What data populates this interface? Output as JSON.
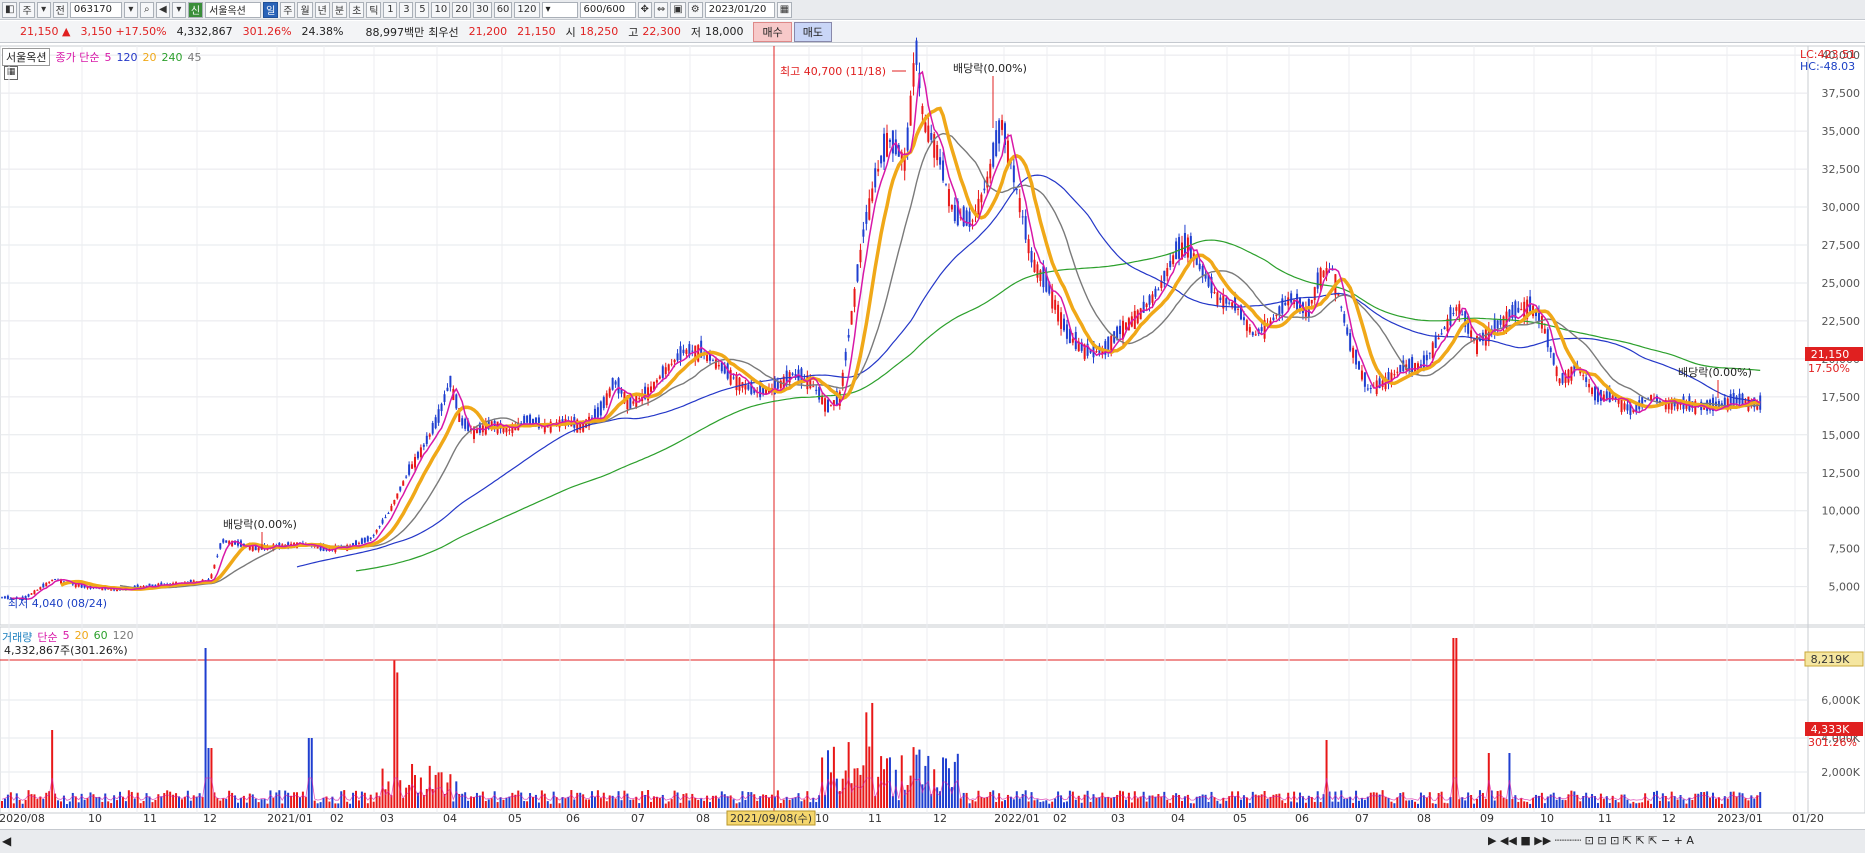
{
  "toolbar": {
    "b1": "주",
    "b2": "전",
    "code": "063170",
    "b3": "신",
    "name": "서울옥션",
    "periods": [
      "일",
      "주",
      "월",
      "년",
      "분",
      "초",
      "틱"
    ],
    "nums": [
      "1",
      "3",
      "5",
      "10",
      "20",
      "30",
      "60",
      "120"
    ],
    "count": "600/600",
    "date": "2023/01/20"
  },
  "quote": {
    "price": "21,150 ▲",
    "change": "3,150 +17.50%",
    "volume": "4,332,867",
    "vol_ratio": "301.26%",
    "turnover": "24.38%",
    "amount": "88,997백만",
    "best": "최우선",
    "bid": "21,200",
    "ask": "21,150",
    "open_label": "시",
    "open": "18,250",
    "high_label": "고",
    "high": "22,300",
    "low_label": "저",
    "low": "18,000",
    "buy": "매수",
    "sell": "매도"
  },
  "price_legend": {
    "name": "서울옥션",
    "type": "종가 단순",
    "ma5": "5",
    "ma120": "120",
    "ma20": "20",
    "ma240": "240",
    "ma45": "45"
  },
  "volume_legend": {
    "name": "거래량",
    "type": "단순",
    "ma5": "5",
    "ma20": "20",
    "ma60": "60",
    "ma120": "120",
    "value": "4,332,867주(301.26%)"
  },
  "right_labels": {
    "lc": "LC:423.51",
    "hc": "HC:-48.03",
    "cur_price": "21,150",
    "cur_pct": "17.50%",
    "vol_line": "8,219K",
    "vol_cur": "4,333K",
    "vol_pct": "301.26%"
  },
  "annotations": {
    "high": "최고 40,700 (11/18)",
    "low": "최저 4,040 (08/24)",
    "div1": "배당락(0.00%)",
    "div2": "배당락(0.00%)",
    "div3": "배당락(0.00%)",
    "cursor_date": "2021/09/08(수)"
  },
  "colors": {
    "up": "#e81818",
    "down": "#1f3fd0",
    "ma5": "#d818a8",
    "ma20": "#f0a818",
    "ma45": "#7a7a7a",
    "ma120": "#2437c8",
    "ma240": "#2ca02c"
  },
  "chart_data": {
    "type": "candlestick",
    "ylim": [
      3000,
      41000
    ],
    "price_ticks": [
      "40,000",
      "37,500",
      "35,000",
      "32,500",
      "30,000",
      "27,500",
      "25,000",
      "22,500",
      "20,000",
      "17,500",
      "15,000",
      "12,500",
      "10,000",
      "7,500",
      "5,000"
    ],
    "vol_ticks": [
      "6,000K",
      "4,000K",
      "2,000K"
    ],
    "x_ticks": [
      "2020/08",
      "10",
      "11",
      "12",
      "2021/01",
      "02",
      "03",
      "04",
      "05",
      "06",
      "07",
      "08",
      "2021/09/08(수)",
      "10",
      "11",
      "12",
      "2022/01",
      "02",
      "03",
      "04",
      "05",
      "06",
      "07",
      "08",
      "09",
      "10",
      "11",
      "12",
      "2023/01",
      "01/20"
    ],
    "price_series": [
      [
        0,
        4300
      ],
      [
        20,
        4200
      ],
      [
        45,
        5500
      ],
      [
        70,
        5000
      ],
      [
        100,
        4800
      ],
      [
        130,
        5100
      ],
      [
        150,
        5200
      ],
      [
        175,
        5400
      ],
      [
        185,
        8000
      ],
      [
        200,
        7800
      ],
      [
        215,
        7500
      ],
      [
        235,
        7700
      ],
      [
        255,
        7800
      ],
      [
        270,
        7500
      ],
      [
        290,
        7600
      ],
      [
        310,
        8200
      ],
      [
        325,
        10000
      ],
      [
        340,
        12500
      ],
      [
        355,
        14500
      ],
      [
        365,
        16000
      ],
      [
        375,
        18500
      ],
      [
        385,
        15800
      ],
      [
        395,
        15200
      ],
      [
        410,
        15700
      ],
      [
        425,
        15300
      ],
      [
        440,
        16000
      ],
      [
        455,
        15500
      ],
      [
        470,
        15900
      ],
      [
        485,
        15600
      ],
      [
        500,
        16500
      ],
      [
        512,
        18500
      ],
      [
        525,
        17000
      ],
      [
        540,
        17800
      ],
      [
        555,
        19300
      ],
      [
        570,
        20500
      ],
      [
        585,
        20500
      ],
      [
        600,
        19500
      ],
      [
        615,
        18500
      ],
      [
        630,
        17800
      ],
      [
        645,
        18000
      ],
      [
        660,
        19000
      ],
      [
        675,
        18500
      ],
      [
        690,
        16800
      ],
      [
        700,
        17500
      ],
      [
        710,
        23000
      ],
      [
        720,
        28500
      ],
      [
        730,
        32000
      ],
      [
        740,
        34500
      ],
      [
        755,
        33000
      ],
      [
        763,
        40500
      ],
      [
        770,
        35500
      ],
      [
        780,
        34000
      ],
      [
        795,
        29500
      ],
      [
        810,
        29000
      ],
      [
        822,
        31500
      ],
      [
        835,
        35500
      ],
      [
        845,
        32000
      ],
      [
        860,
        26500
      ],
      [
        875,
        24500
      ],
      [
        890,
        21500
      ],
      [
        905,
        20500
      ],
      [
        920,
        20500
      ],
      [
        935,
        22000
      ],
      [
        950,
        23000
      ],
      [
        965,
        24500
      ],
      [
        980,
        27000
      ],
      [
        990,
        27500
      ],
      [
        1000,
        26000
      ],
      [
        1015,
        24000
      ],
      [
        1030,
        23500
      ],
      [
        1045,
        21500
      ],
      [
        1060,
        22500
      ],
      [
        1075,
        24000
      ],
      [
        1090,
        23000
      ],
      [
        1100,
        25500
      ],
      [
        1110,
        26000
      ],
      [
        1125,
        21000
      ],
      [
        1140,
        18000
      ],
      [
        1155,
        18500
      ],
      [
        1170,
        19500
      ],
      [
        1185,
        19500
      ],
      [
        1200,
        21500
      ],
      [
        1215,
        23500
      ],
      [
        1230,
        21000
      ],
      [
        1245,
        22000
      ],
      [
        1260,
        23000
      ],
      [
        1275,
        23500
      ],
      [
        1285,
        22500
      ],
      [
        1300,
        18500
      ],
      [
        1315,
        19500
      ],
      [
        1330,
        17500
      ],
      [
        1345,
        17500
      ],
      [
        1360,
        16500
      ],
      [
        1375,
        17500
      ],
      [
        1390,
        17000
      ],
      [
        1405,
        17000
      ],
      [
        1420,
        16800
      ],
      [
        1435,
        17000
      ],
      [
        1450,
        17300
      ],
      [
        1465,
        17000
      ],
      [
        1475,
        17000
      ],
      [
        1480,
        21150
      ]
    ]
  }
}
